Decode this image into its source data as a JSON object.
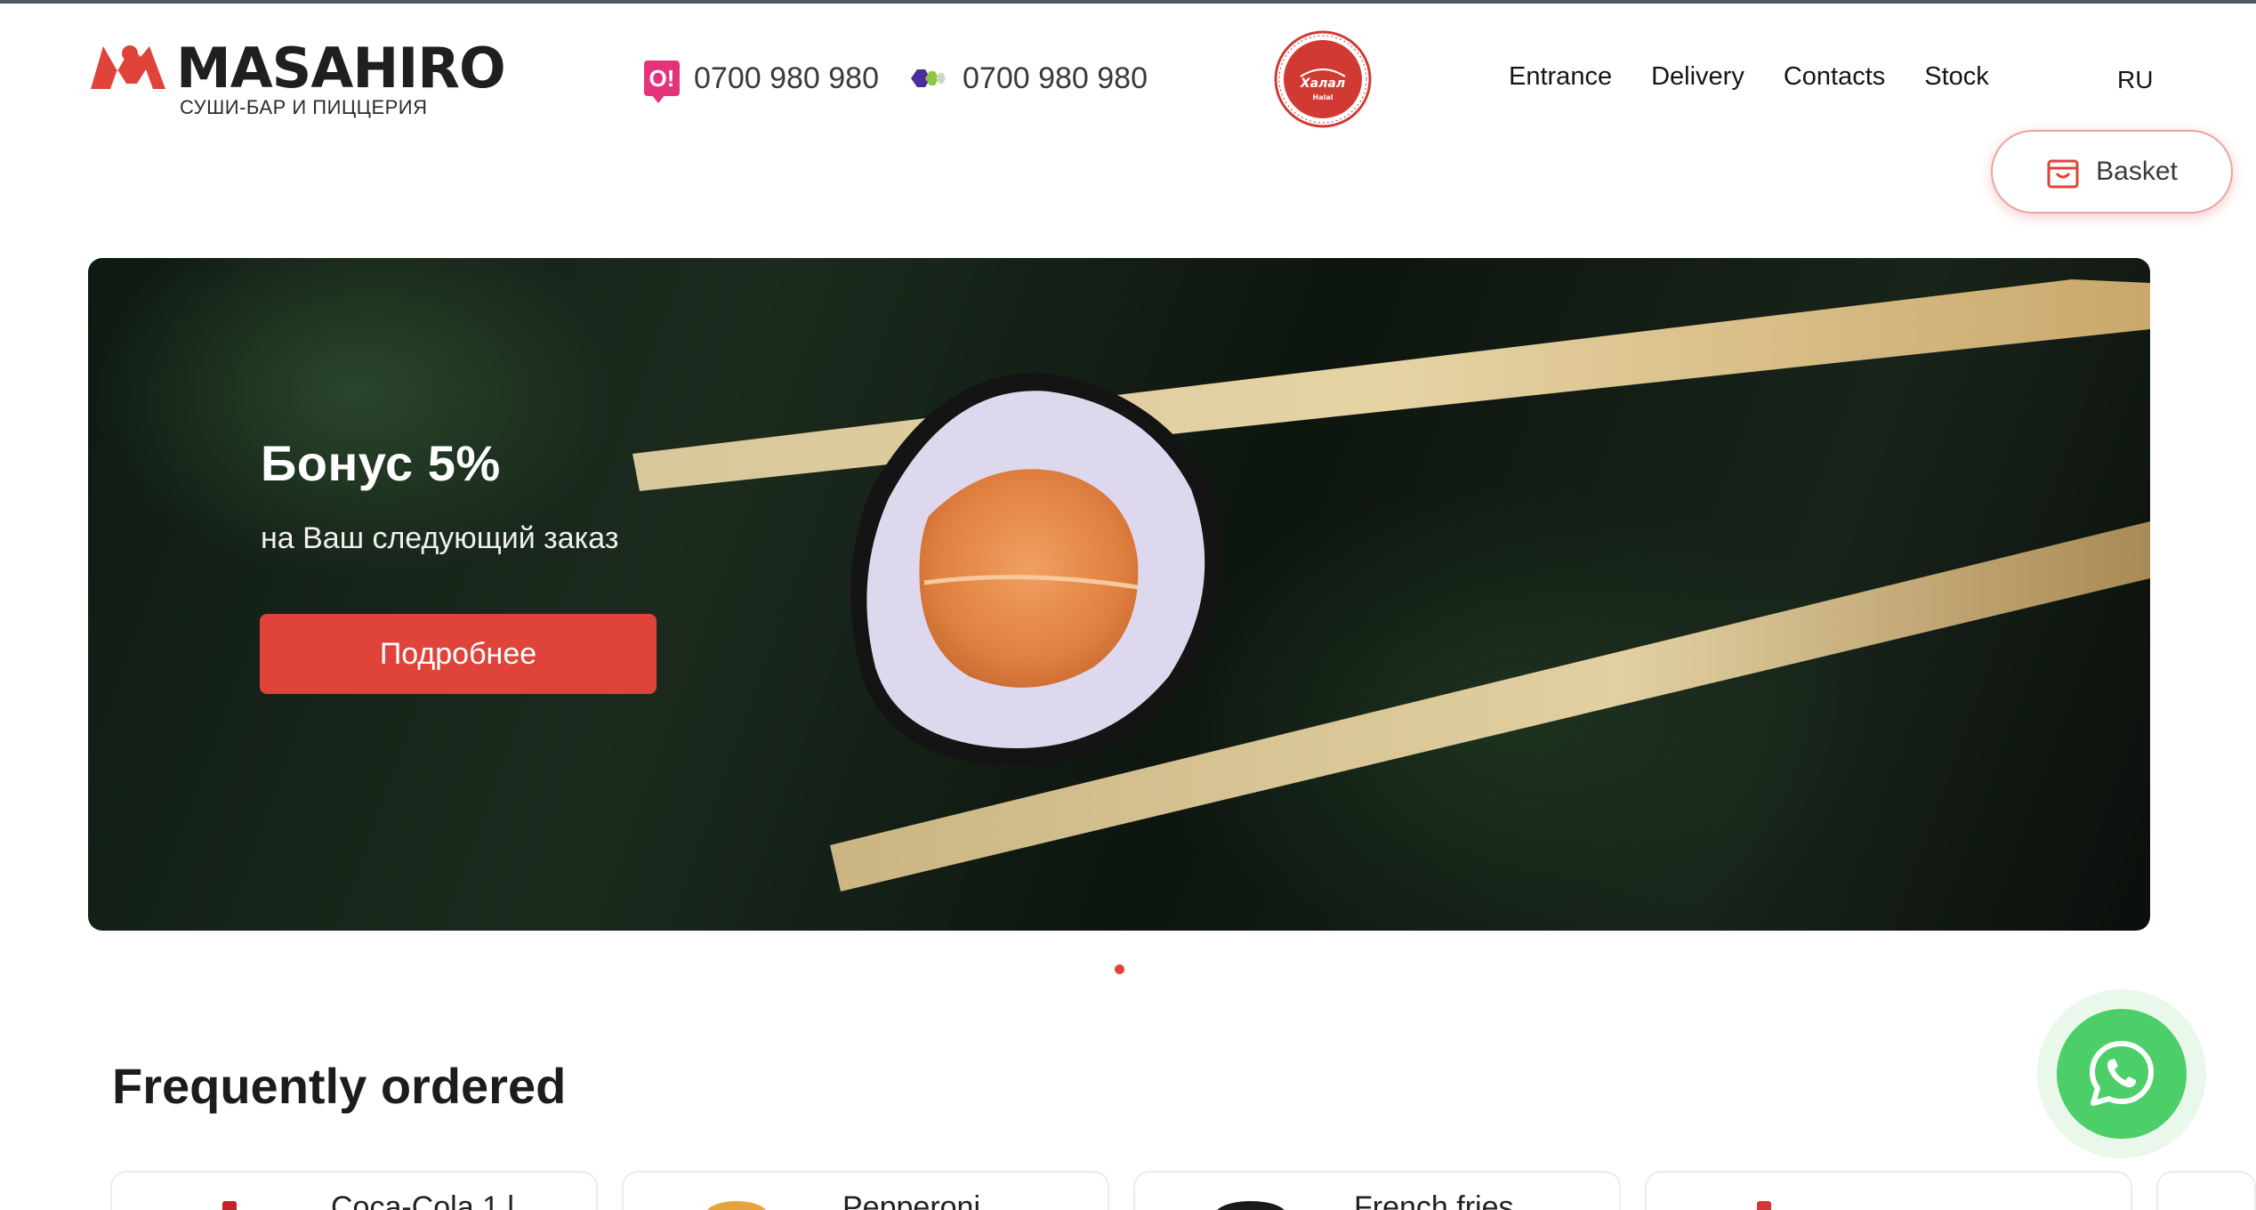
{
  "header": {
    "logo_word": "MASAHIRO",
    "logo_sub": "СУШИ-БАР И ПИЦЦЕРИЯ",
    "phones": [
      {
        "operator_icon": "o-operator-icon",
        "number": "0700 980 980"
      },
      {
        "operator_icon": "megacom-operator-icon",
        "number": "0700 980 980"
      }
    ],
    "halal_badge": "halal-badge-icon",
    "nav": [
      "Entrance",
      "Delivery",
      "Contacts",
      "Stock"
    ],
    "lang": "RU",
    "basket_label": "Basket"
  },
  "banner": {
    "title": "Бонус 5%",
    "subtitle": "на Ваш следующий заказ",
    "button": "Подробнее",
    "slides_total": 1,
    "active_slide": 1
  },
  "frequently": {
    "title": "Frequently ordered",
    "items": [
      {
        "name": "Coca-Cola 1 l"
      },
      {
        "name": "Pepperoni"
      },
      {
        "name": "French fries"
      },
      {
        "name": ""
      }
    ]
  },
  "colors": {
    "accent": "#e0433a",
    "whatsapp": "#4ccf68",
    "operator_o": "#e5337b",
    "text": "#1e1e1e"
  }
}
